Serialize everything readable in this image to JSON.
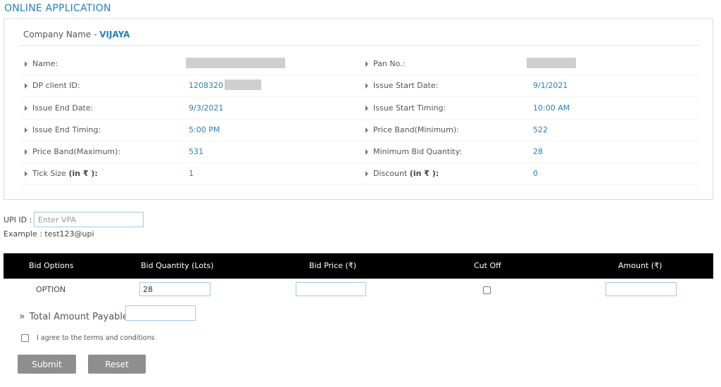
{
  "page": {
    "title": "ONLINE APPLICATION"
  },
  "company": {
    "label": "Company Name - ",
    "name": "VIJAYA"
  },
  "fields_left": [
    {
      "label": "Name:",
      "value": ""
    },
    {
      "label": "DP client ID:",
      "value": "1208320"
    },
    {
      "label": "Issue End Date:",
      "value": "9/3/2021"
    },
    {
      "label": "Issue End Timing:",
      "value": "5:00 PM"
    },
    {
      "label": "Price Band(Maximum):",
      "value": "531"
    },
    {
      "label": "Tick Size ",
      "label_bold": "(in ₹ ):",
      "value": "1"
    }
  ],
  "fields_right": [
    {
      "label": "Pan No.:",
      "value": ""
    },
    {
      "label": "Issue Start Date:",
      "value": "9/1/2021"
    },
    {
      "label": "Issue Start Timing:",
      "value": "10:00 AM"
    },
    {
      "label": "Price Band(Minimum):",
      "value": "522"
    },
    {
      "label": "Minimum Bid Quantity:",
      "value": "28"
    },
    {
      "label": "Discount ",
      "label_bold": "(in ₹ ):",
      "value": "0"
    }
  ],
  "upi": {
    "label": "UPI ID :",
    "placeholder": "Enter VPA",
    "example": "Example : test123@upi"
  },
  "bid_table": {
    "headers": [
      "Bid Options",
      "Bid Quantity (Lots)",
      "Bid Price (₹)",
      "Cut Off",
      "Amount (₹)"
    ],
    "row": {
      "option": "OPTION",
      "quantity": "28",
      "price": "",
      "cut_off": false,
      "amount": ""
    }
  },
  "total": {
    "label": "Total Amount Payable",
    "value": ""
  },
  "terms": {
    "label": "I agree to the terms and conditions",
    "checked": false
  },
  "buttons": {
    "submit": "Submit",
    "reset": "Reset"
  }
}
